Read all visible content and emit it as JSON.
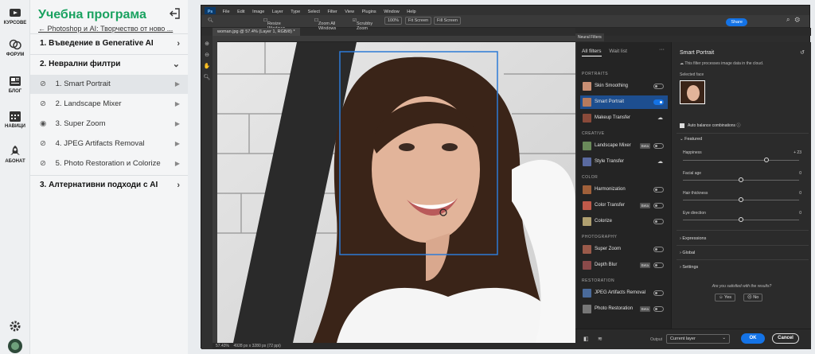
{
  "rail": {
    "items": [
      {
        "label": "КУРСОВЕ"
      },
      {
        "label": "ФОРУМ"
      },
      {
        "label": "БЛОГ"
      },
      {
        "label": "НАВИЦИ"
      },
      {
        "label": "АБОНАТ"
      }
    ]
  },
  "course": {
    "title": "Учебна програма",
    "subtitle": "← Photoshop и AI: Творчество от ново ...",
    "sections": [
      {
        "label": "1. Въведение в Generative AI"
      },
      {
        "label": "2. Неврални филтри"
      },
      {
        "label": "3. Алтернативни подходи с AI"
      }
    ],
    "lessons": [
      {
        "label": "1. Smart Portrait",
        "active": true
      },
      {
        "label": "2. Landscape Mixer",
        "active": false
      },
      {
        "label": "3. Super Zoom",
        "active": false
      },
      {
        "label": "4. JPEG Artifacts Removal",
        "active": false
      },
      {
        "label": "5. Photo Restoration и Colorize",
        "active": false
      }
    ]
  },
  "ps": {
    "menu": [
      "File",
      "Edit",
      "Image",
      "Layer",
      "Type",
      "Select",
      "Filter",
      "View",
      "Plugins",
      "Window",
      "Help"
    ],
    "options": {
      "resize": "Resize Windows to Fit",
      "zoom_all": "Zoom All Windows",
      "scrubby": "Scrubby Zoom",
      "pct": "100%",
      "fit": "Fit Screen",
      "fill": "Fill Screen"
    },
    "share": "Share",
    "doc_tab": "woman.jpg @ 57.4% (Layer 1, RGB/8) *",
    "status_zoom": "57.43%",
    "status_info": "4928 px x 3280 px (72 ppi)"
  },
  "nf": {
    "panel_tab": "Neural Filters",
    "tabs": {
      "all": "All filters",
      "wait": "Wait list"
    },
    "categories": {
      "portraits": "PORTRAITS",
      "creative": "CREATIVE",
      "color": "COLOR",
      "photography": "PHOTOGRAPHY",
      "restoration": "RESTORATION"
    },
    "filters": {
      "skin": "Skin Smoothing",
      "smart": "Smart Portrait",
      "makeup": "Makeup Transfer",
      "landscape": "Landscape Mixer",
      "style": "Style Transfer",
      "harmonization": "Harmonization",
      "colortransfer": "Color Transfer",
      "colorize": "Colorize",
      "superzoom": "Super Zoom",
      "depthblur": "Depth Blur",
      "jpeg": "JPEG Artifacts Removal",
      "photorestore": "Photo Restoration"
    },
    "beta": "Beta",
    "settings": {
      "title": "Smart Portrait",
      "desc": "This filter processes image data in the cloud.",
      "selected_face": "Selected face",
      "auto_balance": "Auto balance combinations",
      "featured": "Featured",
      "sliders": [
        {
          "name": "Happiness",
          "value": "+ 23",
          "pos": 0.72
        },
        {
          "name": "Facial age",
          "value": "0",
          "pos": 0.5
        },
        {
          "name": "Hair thickness",
          "value": "0",
          "pos": 0.5
        },
        {
          "name": "Eye direction",
          "value": "0",
          "pos": 0.5
        }
      ],
      "expressions": "Expressions",
      "global": "Global",
      "settings": "Settings",
      "question": "Are you satisfied with the results?",
      "yes": "Yes",
      "no": "No"
    },
    "footer": {
      "output_label": "Output",
      "output_value": "Current layer",
      "ok": "OK",
      "cancel": "Cancel"
    }
  }
}
